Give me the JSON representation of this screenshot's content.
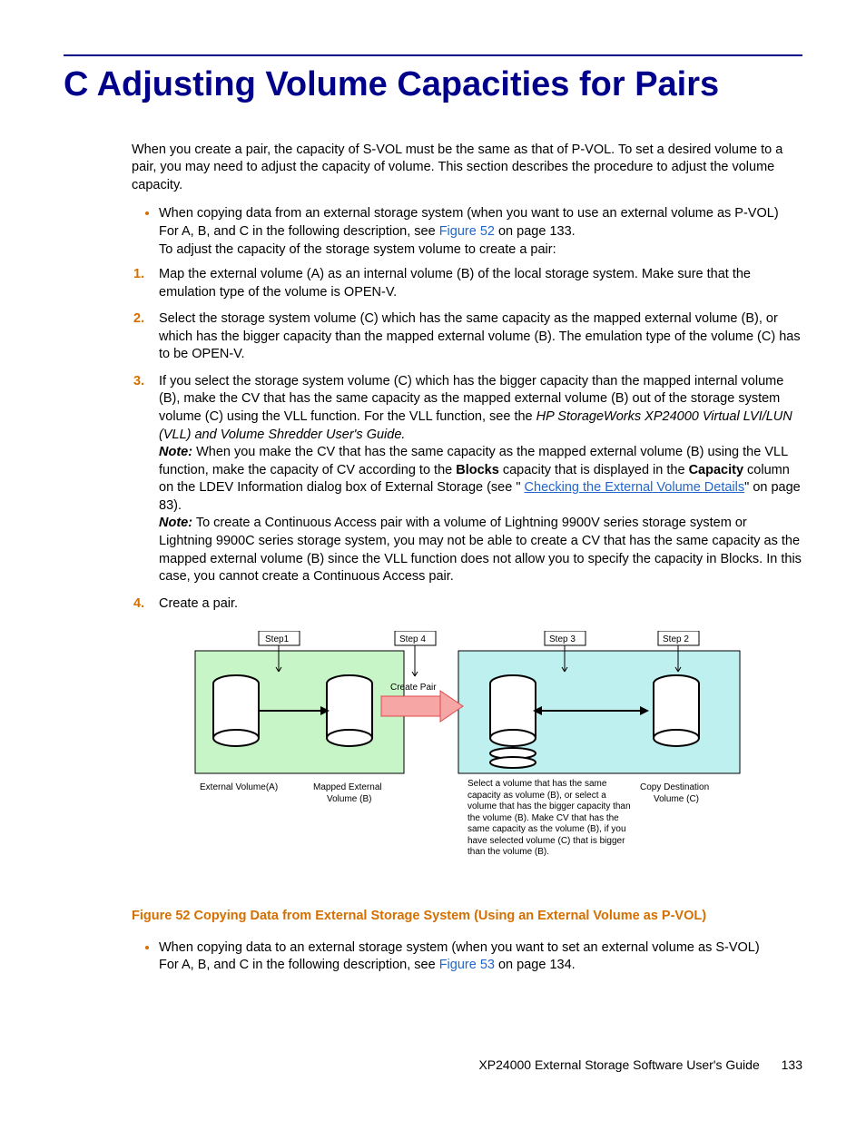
{
  "heading": "C Adjusting Volume Capacities for Pairs",
  "intro": "When you create a pair, the capacity of S-VOL must be the same as that of P-VOL. To set a desired volume to a pair, you may need to adjust the capacity of volume. This section describes the procedure to adjust the volume capacity.",
  "bullet1": {
    "line1": "When copying data from an external storage system (when you want to use an external volume as P-VOL)",
    "line2a": "For A, B, and C in the following description, see ",
    "line2link": "Figure 52",
    "line2b": " on page 133.",
    "line3": "To adjust the capacity of the storage system volume to create a pair:"
  },
  "steps": {
    "n1": "1.",
    "s1": "Map the external volume (A) as an internal volume (B) of the local storage system. Make sure that the emulation type of the volume is OPEN-V.",
    "n2": "2.",
    "s2": "Select the storage system volume (C) which has the same capacity as the mapped external volume (B), or which has the bigger capacity than the mapped external volume (B). The emulation type of the volume (C) has to be OPEN-V.",
    "n3": "3.",
    "s3a": "If you select the storage system volume (C) which has the bigger capacity than the mapped internal volume (B), make the CV that has the same capacity as the mapped external volume (B) out of the storage system volume (C) using the VLL function. For the VLL function, see the ",
    "s3guide": "HP StorageWorks XP24000 Virtual LVI/LUN (VLL) and Volume Shredder User's Guide.",
    "s3note1a": "Note:",
    "s3note1b": " When you make the CV that has the same capacity as the mapped external volume (B) using the VLL function, make the capacity of CV according to the ",
    "s3blocks": "Blocks",
    "s3note1c": " capacity that is displayed in the ",
    "s3capacity": "Capacity",
    "s3note1d": " column on the LDEV Information dialog box of External Storage (see \" ",
    "s3link": "Checking the External Volume Details",
    "s3note1e": "\" on page 83).",
    "s3note2a": "Note:",
    "s3note2b": " To create a Continuous Access pair with a volume of Lightning 9900V series storage system or Lightning 9900C series storage system, you may not be able to create a CV that has the same capacity as the mapped external volume (B) since the VLL function does not allow you to specify the capacity in Blocks. In this case, you cannot create a Continuous Access pair.",
    "n4": "4.",
    "s4": "Create a pair."
  },
  "diagram": {
    "step1": "Step1",
    "step2": "Step 2",
    "step3": "Step 3",
    "step4": "Step 4",
    "createpair": "Create Pair",
    "extvolA": "External Volume(A)",
    "mappedB": "Mapped External Volume (B)",
    "selectC": "Select a volume that has the same capacity as volume (B), or select a volume that has the bigger capacity than the volume (B). Make CV that has the same capacity as the volume (B), if you have selected volume (C) that is bigger than the volume (B).",
    "copyDestC": "Copy Destination Volume (C)"
  },
  "figcaption": "Figure 52 Copying Data from External Storage System (Using an External Volume as P-VOL)",
  "bullet2": {
    "line1": "When copying data to an external storage system (when you want to set an external volume as S-VOL)",
    "line2a": "For A, B, and C in the following description, see ",
    "line2link": "Figure 53",
    "line2b": " on page 134."
  },
  "footer": {
    "doc": "XP24000 External Storage Software User's Guide",
    "page": "133"
  }
}
